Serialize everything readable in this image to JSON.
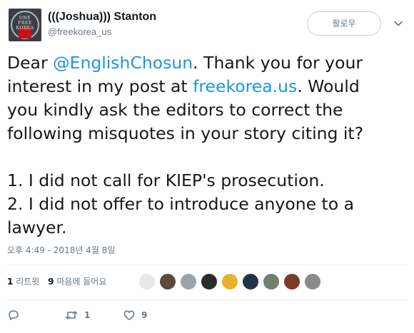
{
  "user": {
    "display_name": "(((Joshua))) Stanton",
    "screen_name": "@freekorea_us",
    "avatar_text": [
      "ONE",
      "FREE",
      "KOREA"
    ]
  },
  "follow_label": "팔로우",
  "tweet": {
    "line1_pre": "Dear ",
    "line1_mention": "@EnglishChosun",
    "line1_post": ". Thank you for your",
    "line2_pre": "interest in my post at ",
    "line2_link": "freekorea.us",
    "line2_post": ". Would",
    "line3": "you kindly ask the editors to correct the",
    "line4": "following misquotes in your story citing it?",
    "line5": "1. I did not call for KIEP's prosecution.",
    "line6": "2. I did not offer to introduce anyone to a",
    "line7": "lawyer."
  },
  "timestamp": "오후 4:49 - 2018년 4월 8일",
  "stats": {
    "retweets_count": "1",
    "retweets_label": "리트윗",
    "likes_count": "9",
    "likes_label": "마음에 들어요"
  },
  "likers": [
    "#e8e8e8",
    "#5a4a40",
    "#9aa4ad",
    "#2b2b2b",
    "#e8b22a",
    "#243447",
    "#6f7f6a",
    "#7a3b2a",
    "#8a8a8a"
  ],
  "actions": {
    "reply_icon": "reply-icon",
    "retweet_count": "1",
    "like_count": "9"
  },
  "colors": {
    "link": "#1b95e0",
    "muted": "#657786",
    "text": "#14171a"
  }
}
